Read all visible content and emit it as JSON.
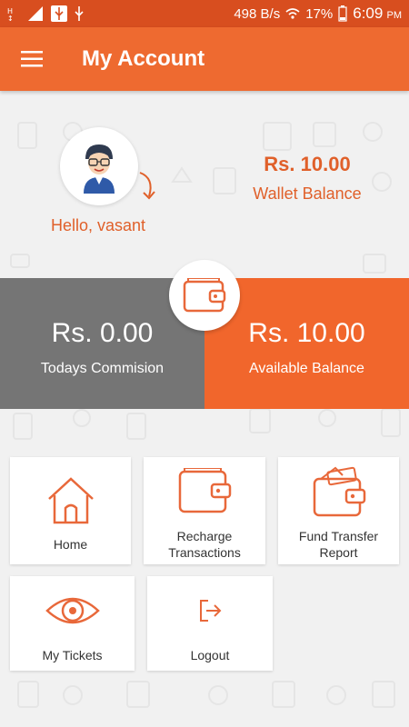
{
  "status_bar": {
    "left_icons": [
      "signal-h-icon",
      "signal-bars-icon",
      "usb-icon",
      "usb-icon"
    ],
    "speed": "498 B/s",
    "battery": "17%",
    "time": "6:09",
    "ampm": "PM"
  },
  "app_bar": {
    "title": "My Account",
    "menu_icon": "hamburger-icon"
  },
  "profile": {
    "greeting": "Hello, vasant",
    "wallet_amount": "Rs. 10.00",
    "wallet_label": "Wallet Balance"
  },
  "balances": {
    "commission_amount": "Rs. 0.00",
    "commission_label": "Todays Commision",
    "available_amount": "Rs. 10.00",
    "available_label": "Available Balance"
  },
  "menu": {
    "home": "Home",
    "recharge_line1": "Recharge",
    "recharge_line2": "Transactions",
    "fund_line1": "Fund Transfer",
    "fund_line2": "Report",
    "tickets": "My Tickets",
    "logout": "Logout"
  },
  "colors": {
    "primary": "#ee6a30",
    "status_bar": "#d84e1f",
    "accent_text": "#e0602a",
    "commission_bg": "#757575",
    "available_bg": "#f1662c"
  }
}
